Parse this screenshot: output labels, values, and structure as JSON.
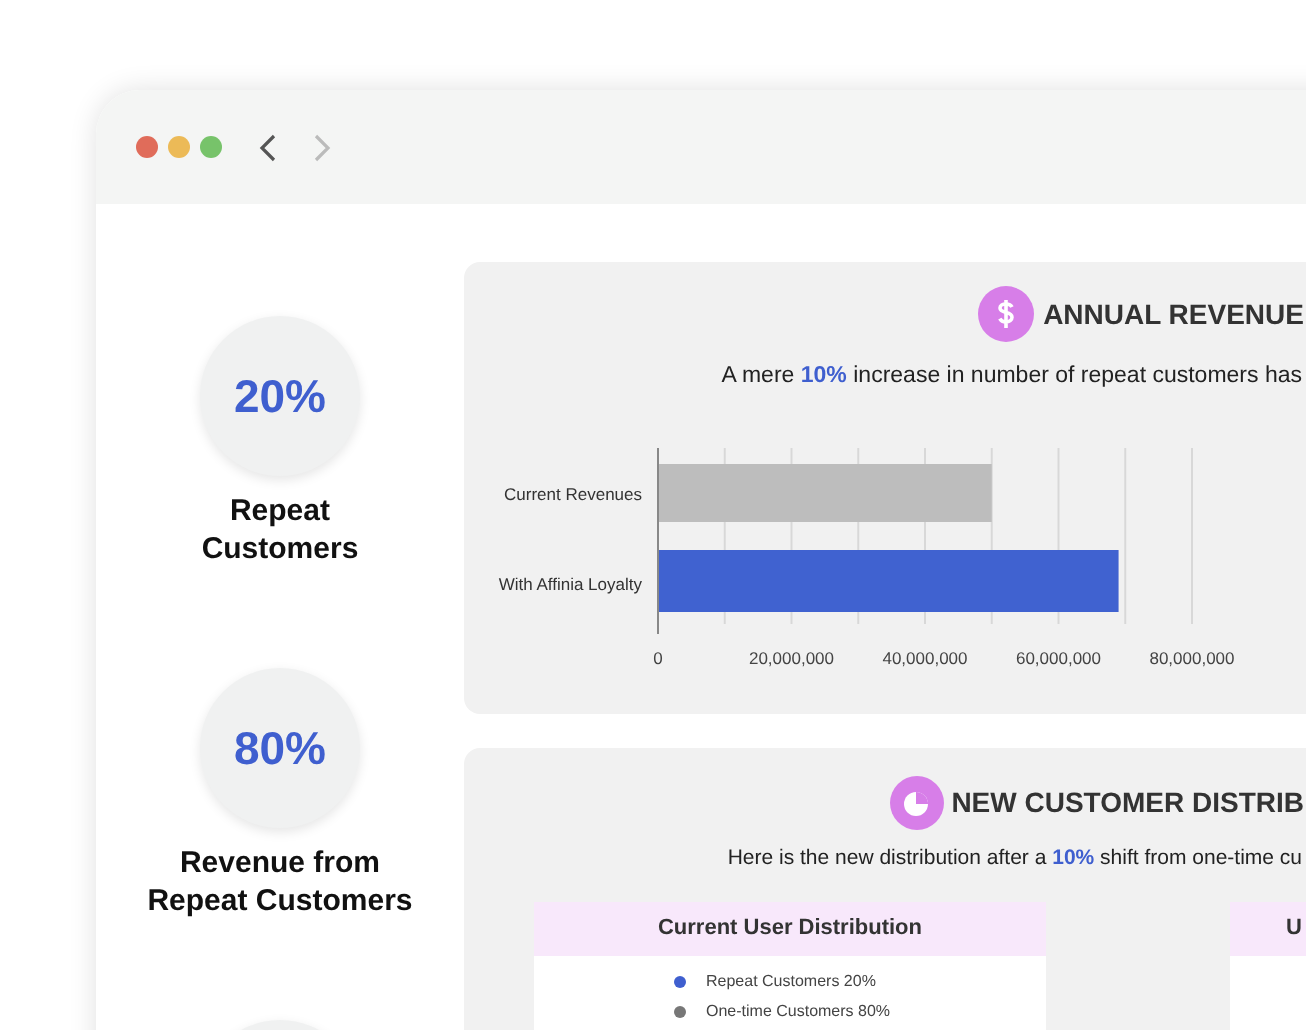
{
  "stats": [
    {
      "value": "20%",
      "label_lines": [
        "Repeat",
        "Customers"
      ]
    },
    {
      "value": "80%",
      "label_lines": [
        "Revenue from",
        "Repeat Customers"
      ]
    }
  ],
  "revenue_panel": {
    "title": "ANNUAL REVENUE",
    "subtitle": {
      "before": "A mere",
      "highlight": "10%",
      "after": "increase in number of repeat customers has"
    },
    "chart_data": {
      "type": "bar",
      "orientation": "horizontal",
      "grid": true,
      "categories": [
        "Current Revenues",
        "With Affinia Loyalty"
      ],
      "values": [
        50000000,
        69000000
      ],
      "colors": [
        "#bdbdbd",
        "#4062d0"
      ],
      "xlim": [
        0,
        80000000
      ],
      "xticks": [
        {
          "value": 0,
          "label": "0"
        },
        {
          "value": 20000000,
          "label": "20,000,000"
        },
        {
          "value": 40000000,
          "label": "40,000,000"
        },
        {
          "value": 60000000,
          "label": "60,000,000"
        },
        {
          "value": 80000000,
          "label": "80,000,000"
        }
      ]
    }
  },
  "distribution_panel": {
    "title": "NEW CUSTOMER DISTRIB",
    "subtitle": {
      "before": "Here is the new distribution after a",
      "highlight": "10%",
      "after": "shift from one-time cu"
    },
    "cards": [
      {
        "title": "Current User Distribution",
        "legend": [
          {
            "label": "Repeat Customers 20%",
            "color": "#3f5fcf"
          },
          {
            "label": "One-time Customers 80%",
            "color": "#777777"
          }
        ]
      },
      {
        "title": "U"
      }
    ]
  }
}
